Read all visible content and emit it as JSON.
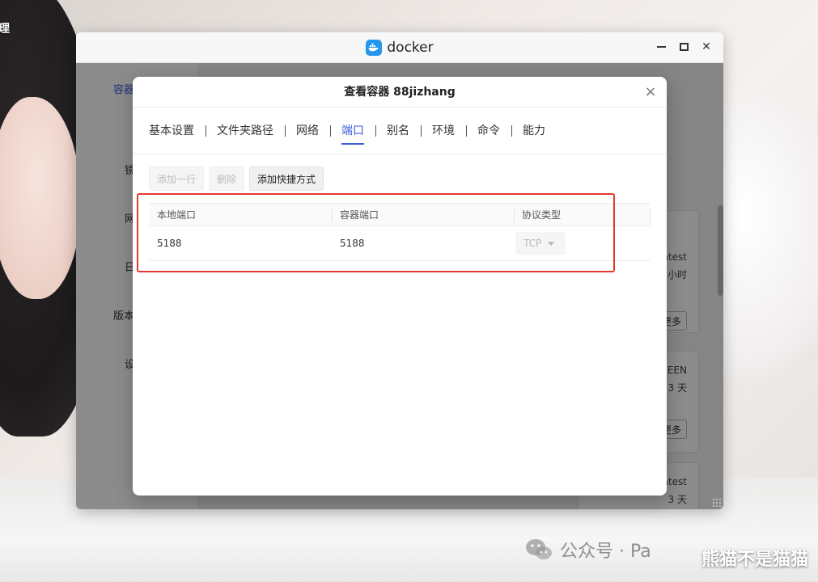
{
  "desktop": {
    "label": "理"
  },
  "window": {
    "title": "docker",
    "sidebar": {
      "items": [
        {
          "label": "容器",
          "active": true
        },
        {
          "label": "镜"
        },
        {
          "label": "网"
        },
        {
          "label": "日"
        },
        {
          "label": "版本"
        },
        {
          "label": "设"
        }
      ]
    },
    "cards": [
      {
        "line1": "atest",
        "line2": "小时",
        "button": "更多"
      },
      {
        "line1": "REEN",
        "line2": "3 天",
        "button": "更多"
      },
      {
        "line1": "atest",
        "line2": "3 天"
      }
    ]
  },
  "modal": {
    "title": "查看容器 88jizhang",
    "close_glyph": "×",
    "tabs": [
      {
        "label": "基本设置"
      },
      {
        "label": "文件夹路径"
      },
      {
        "label": "网络"
      },
      {
        "label": "端口",
        "active": true
      },
      {
        "label": "别名"
      },
      {
        "label": "环境"
      },
      {
        "label": "命令"
      },
      {
        "label": "能力"
      }
    ],
    "toolbar": {
      "add_row": "添加一行",
      "delete": "删除",
      "add_shortcut": "添加快捷方式"
    },
    "port_table": {
      "columns": [
        "本地端口",
        "容器端口",
        "协议类型"
      ],
      "rows": [
        {
          "local_port": "5188",
          "container_port": "5188",
          "protocol": "TCP"
        }
      ]
    }
  },
  "watermark": {
    "text": "公众号 · Pa",
    "signature": "熊猫不是猫猫"
  },
  "colors": {
    "accent": "#3b5bdb",
    "docker_blue": "#2496ed",
    "highlight_red": "#e23a2f"
  }
}
